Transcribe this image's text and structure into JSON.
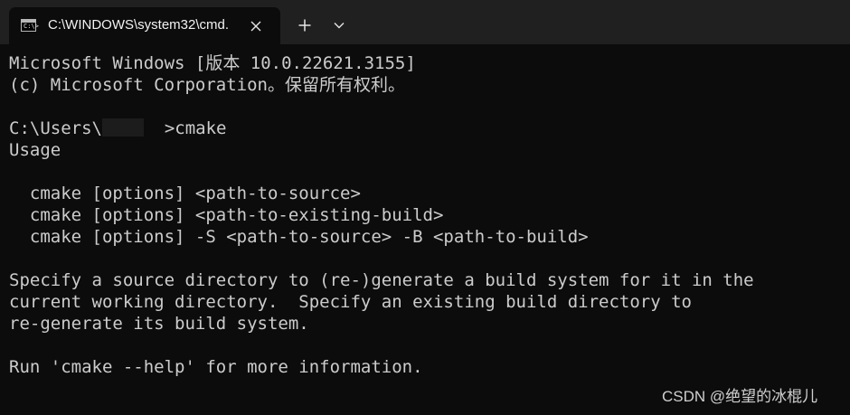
{
  "tab": {
    "title": "C:\\WINDOWS\\system32\\cmd.",
    "icon": "terminal-icon",
    "icon_prompt": "C:\\>"
  },
  "titlebar": {
    "close_icon": "close-icon",
    "newtab_icon": "plus-icon",
    "dropdown_icon": "chevron-down-icon"
  },
  "terminal": {
    "header1": "Microsoft Windows [版本 10.0.22621.3155]",
    "header2": "(c) Microsoft Corporation。保留所有权利。",
    "prompt_prefix": "C:\\Users\\",
    "prompt_command": "  >cmake",
    "usage": "Usage",
    "usage_lines": [
      "  cmake [options] <path-to-source>",
      "  cmake [options] <path-to-existing-build>",
      "  cmake [options] -S <path-to-source> -B <path-to-build>"
    ],
    "desc_lines": [
      "Specify a source directory to (re-)generate a build system for it in the",
      "current working directory.  Specify an existing build directory to",
      "re-generate its build system."
    ],
    "help_line": "Run 'cmake --help' for more information."
  },
  "watermark": "CSDN @绝望的冰棍儿",
  "colors": {
    "background": "#0c0c0c",
    "titlebar": "#202020",
    "text": "#cccccc"
  }
}
